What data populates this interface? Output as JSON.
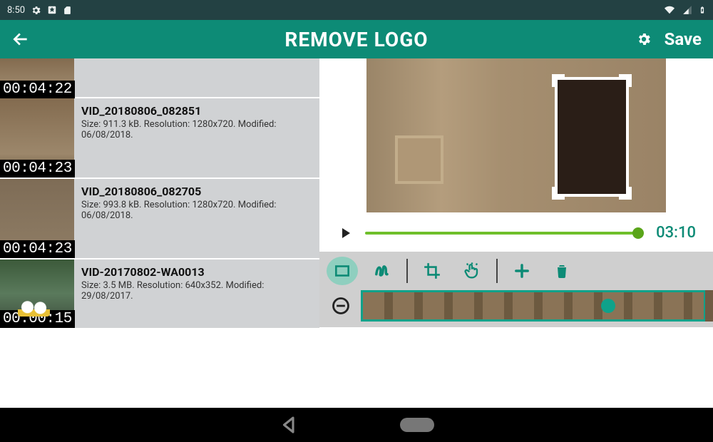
{
  "status_bar": {
    "time": "8:50"
  },
  "app_bar": {
    "title": "REMOVE LOGO",
    "save_label": "Save"
  },
  "video_list": [
    {
      "duration": "00:04:22"
    },
    {
      "title": "VID_20180806_082851",
      "meta": "Size: 911.3 kB. Resolution: 1280x720. Modified: 06/08/2018.",
      "duration": "00:04:23"
    },
    {
      "title": "VID_20180806_082705",
      "meta": "Size: 993.8 kB. Resolution: 1280x720. Modified: 06/08/2018.",
      "duration": "00:04:23"
    },
    {
      "title": "VID-20170802-WA0013",
      "meta": "Size: 3.5 MB. Resolution: 640x352. Modified: 29/08/2017.",
      "duration": "00:00:15"
    }
  ],
  "playback": {
    "current_time": "03:10"
  }
}
